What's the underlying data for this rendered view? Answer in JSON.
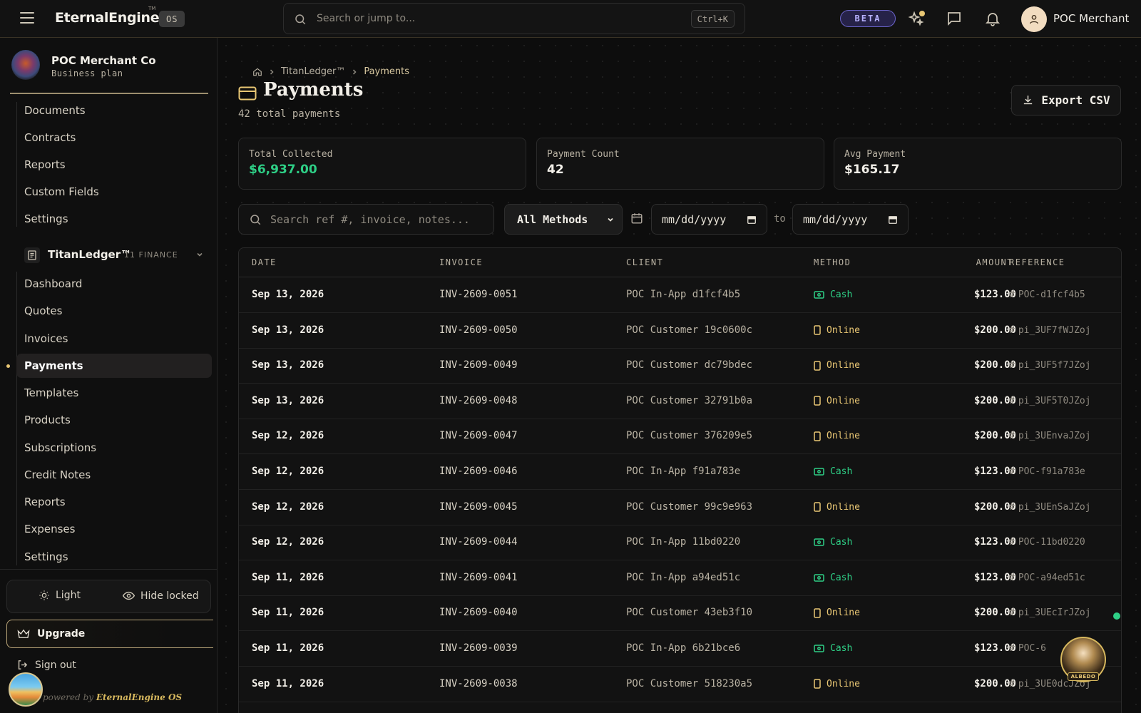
{
  "topbar": {
    "brand": "EternalEngine",
    "tm": "TM",
    "os_badge": "OS",
    "search_placeholder": "Search or jump to...",
    "search_shortcut": "Ctrl+K",
    "beta_label": "BETA",
    "user_name": "POC Merchant"
  },
  "sidebar": {
    "org_name": "POC Merchant Co",
    "org_plan": "Business plan",
    "top_items": [
      "Documents",
      "Contracts",
      "Reports",
      "Custom Fields",
      "Settings"
    ],
    "group": {
      "title": "TitanLedger™",
      "count": "11 FINANCE"
    },
    "group_items": [
      "Dashboard",
      "Quotes",
      "Invoices",
      "Payments",
      "Templates",
      "Products",
      "Subscriptions",
      "Credit Notes",
      "Reports",
      "Expenses",
      "Settings"
    ],
    "active_item": "Payments",
    "theme_toggle": "Light",
    "hide_locked": "Hide locked",
    "upgrade": "Upgrade",
    "sign_out": "Sign out",
    "powered_by": "powered by",
    "powered_brand": "EternalEngine OS"
  },
  "breadcrumb": {
    "parent": "TitanLedger™",
    "current": "Payments"
  },
  "page": {
    "title": "Payments",
    "subtitle": "42 total payments",
    "export_label": "Export CSV"
  },
  "stats": [
    {
      "label": "Total Collected",
      "value": "$6,937.00",
      "accent": "#2ecf86"
    },
    {
      "label": "Payment Count",
      "value": "42"
    },
    {
      "label": "Avg Payment",
      "value": "$165.17"
    }
  ],
  "filters": {
    "search_placeholder": "Search ref #, invoice, notes...",
    "method_value": "All Methods",
    "date_from_placeholder": "mm/dd/yyyy",
    "to_label": "to",
    "date_to_placeholder": "mm/dd/yyyy"
  },
  "table": {
    "columns": [
      "DATE",
      "INVOICE",
      "CLIENT",
      "METHOD",
      "AMOUNT",
      "REFERENCE"
    ],
    "rows": [
      {
        "date": "Sep 13, 2026",
        "invoice": "INV-2609-0051",
        "client": "POC In-App d1fcf4b5",
        "method": "Cash",
        "amount": "$123.00",
        "reference": "POC-d1fcf4b5"
      },
      {
        "date": "Sep 13, 2026",
        "invoice": "INV-2609-0050",
        "client": "POC Customer 19c0600c",
        "method": "Online",
        "amount": "$200.00",
        "reference": "pi_3UF7fWJZoj"
      },
      {
        "date": "Sep 13, 2026",
        "invoice": "INV-2609-0049",
        "client": "POC Customer dc79bdec",
        "method": "Online",
        "amount": "$200.00",
        "reference": "pi_3UF5f7JZoj"
      },
      {
        "date": "Sep 13, 2026",
        "invoice": "INV-2609-0048",
        "client": "POC Customer 32791b0a",
        "method": "Online",
        "amount": "$200.00",
        "reference": "pi_3UF5T0JZoj"
      },
      {
        "date": "Sep 12, 2026",
        "invoice": "INV-2609-0047",
        "client": "POC Customer 376209e5",
        "method": "Online",
        "amount": "$200.00",
        "reference": "pi_3UEnvaJZoj"
      },
      {
        "date": "Sep 12, 2026",
        "invoice": "INV-2609-0046",
        "client": "POC In-App f91a783e",
        "method": "Cash",
        "amount": "$123.00",
        "reference": "POC-f91a783e"
      },
      {
        "date": "Sep 12, 2026",
        "invoice": "INV-2609-0045",
        "client": "POC Customer 99c9e963",
        "method": "Online",
        "amount": "$200.00",
        "reference": "pi_3UEnSaJZoj"
      },
      {
        "date": "Sep 12, 2026",
        "invoice": "INV-2609-0044",
        "client": "POC In-App 11bd0220",
        "method": "Cash",
        "amount": "$123.00",
        "reference": "POC-11bd0220"
      },
      {
        "date": "Sep 11, 2026",
        "invoice": "INV-2609-0041",
        "client": "POC In-App a94ed51c",
        "method": "Cash",
        "amount": "$123.00",
        "reference": "POC-a94ed51c"
      },
      {
        "date": "Sep 11, 2026",
        "invoice": "INV-2609-0040",
        "client": "POC Customer 43eb3f10",
        "method": "Online",
        "amount": "$200.00",
        "reference": "pi_3UEcIrJZoj"
      },
      {
        "date": "Sep 11, 2026",
        "invoice": "INV-2609-0039",
        "client": "POC In-App 6b21bce6",
        "method": "Cash",
        "amount": "$123.00",
        "reference": "POC-6"
      },
      {
        "date": "Sep 11, 2026",
        "invoice": "INV-2609-0038",
        "client": "POC Customer 518230a5",
        "method": "Online",
        "amount": "$200.00",
        "reference": "pi_3UE0dcJZoj"
      }
    ]
  },
  "floating": {
    "assistant_label": "ALBEDO"
  },
  "colors": {
    "cash": "#2ecf86",
    "online": "#e9c774",
    "accent_gold": "#cdb98f"
  }
}
